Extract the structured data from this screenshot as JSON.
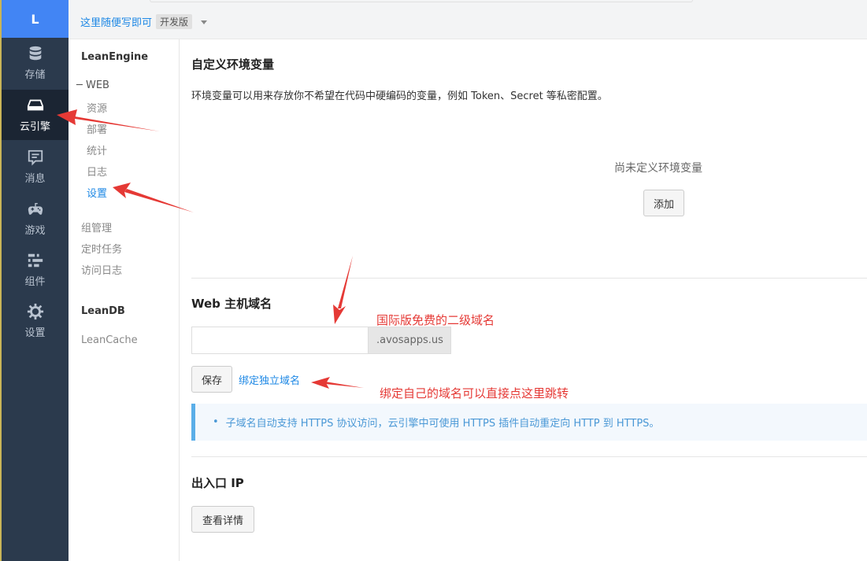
{
  "rail": {
    "logo": "L",
    "items": [
      {
        "label": "存储",
        "icon": "database-icon"
      },
      {
        "label": "云引擎",
        "icon": "server-icon"
      },
      {
        "label": "消息",
        "icon": "message-icon"
      },
      {
        "label": "游戏",
        "icon": "gamepad-icon"
      },
      {
        "label": "组件",
        "icon": "components-icon"
      },
      {
        "label": "设置",
        "icon": "gear-icon"
      }
    ]
  },
  "topbar": {
    "app_name": "这里随便写即可",
    "env_badge": "开发版"
  },
  "subnav": {
    "leanengine": "LeanEngine",
    "web_group": "─ WEB",
    "web_items": [
      "资源",
      "部署",
      "统计",
      "日志",
      "设置"
    ],
    "links": [
      "组管理",
      "定时任务",
      "访问日志"
    ],
    "leandb": "LeanDB",
    "leancache": "LeanCache"
  },
  "env_vars": {
    "title": "自定义环境变量",
    "description": "环境变量可以用来存放你不希望在代码中硬编码的变量，例如 Token、Secret 等私密配置。",
    "empty": "尚未定义环境变量",
    "add_button": "添加"
  },
  "web_domain": {
    "title": "Web 主机域名",
    "input_value": "",
    "suffix": ".avosapps.us",
    "save_button": "保存",
    "bind_link": "绑定独立域名",
    "tip": "子域名自动支持 HTTPS 协议访问，云引擎中可使用 HTTPS 插件自动重定向 HTTP 到 HTTPS。"
  },
  "egress_ip": {
    "title": "出入口 IP",
    "details_button": "查看详情"
  },
  "annotations": {
    "free_domain": "国际版免费的二级域名",
    "bind_hint": "绑定自己的域名可以直接点这里跳转",
    "color": "#e53935"
  }
}
